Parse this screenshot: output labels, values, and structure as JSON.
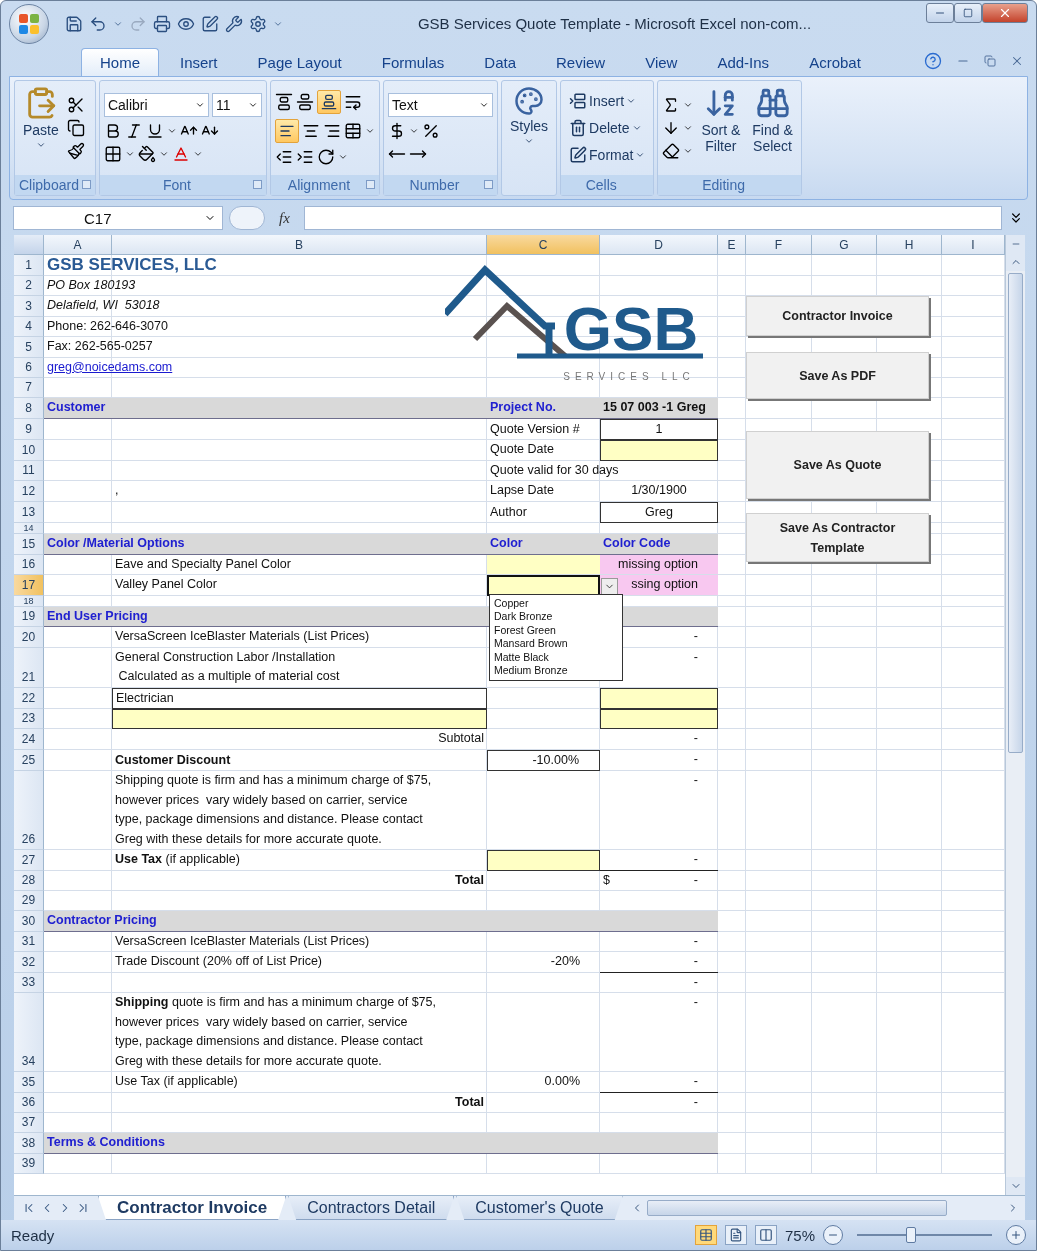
{
  "window": {
    "title": "GSB Services Quote Template - Microsoft Excel non-com..."
  },
  "ribbon_tabs": [
    {
      "label": "Home",
      "selected": true
    },
    {
      "label": "Insert",
      "selected": false
    },
    {
      "label": "Page Layout",
      "selected": false
    },
    {
      "label": "Formulas",
      "selected": false
    },
    {
      "label": "Data",
      "selected": false
    },
    {
      "label": "Review",
      "selected": false
    },
    {
      "label": "View",
      "selected": false
    },
    {
      "label": "Add-Ins",
      "selected": false
    },
    {
      "label": "Acrobat",
      "selected": false
    }
  ],
  "ribbon_groups": [
    {
      "kind": "clipboard",
      "label": "Clipboard",
      "button": "Paste"
    },
    {
      "kind": "font",
      "label": "Font",
      "font_name": "Calibri",
      "font_size": "11"
    },
    {
      "kind": "alignment",
      "label": "Alignment"
    },
    {
      "kind": "number",
      "label": "Number",
      "format": "Text"
    },
    {
      "kind": "styles",
      "button": "Styles"
    },
    {
      "kind": "cells",
      "label": "Cells",
      "buttons": [
        "Insert",
        "Delete",
        "Format"
      ]
    },
    {
      "kind": "editing",
      "label": "Editing",
      "buttons": [
        "Sort &\nFilter",
        "Find &\nSelect"
      ]
    }
  ],
  "formula_bar": {
    "name_box": "C17",
    "function_label": "fx"
  },
  "columns": [
    {
      "label": "A",
      "selected": false
    },
    {
      "label": "B",
      "selected": false
    },
    {
      "label": "C",
      "selected": true
    },
    {
      "label": "D",
      "selected": false
    },
    {
      "label": "E",
      "selected": false
    },
    {
      "label": "F",
      "selected": false
    },
    {
      "label": "G",
      "selected": false
    },
    {
      "label": "H",
      "selected": false
    },
    {
      "label": "I",
      "selected": false
    }
  ],
  "rows": [
    {
      "number": "1",
      "kind": "normal",
      "selected": false,
      "a": {
        "kind": "title",
        "text": "GSB SERVICES, LLC"
      }
    },
    {
      "number": "2",
      "kind": "normal",
      "selected": false,
      "a": {
        "kind": "italic",
        "text": "PO Box 180193"
      }
    },
    {
      "number": "3",
      "kind": "normal",
      "selected": false,
      "a": {
        "kind": "italic",
        "text": "Delafield, WI  53018"
      }
    },
    {
      "number": "4",
      "kind": "normal",
      "selected": false,
      "a": {
        "kind": "text",
        "text": "Phone: 262-646-3070"
      }
    },
    {
      "number": "5",
      "kind": "normal",
      "selected": false,
      "a": {
        "kind": "text",
        "text": "Fax: 262-565-0257"
      }
    },
    {
      "number": "6",
      "kind": "normal",
      "selected": false,
      "a": {
        "kind": "link",
        "text": "greg@noicedams.com"
      }
    },
    {
      "number": "7",
      "kind": "normal",
      "selected": false
    },
    {
      "number": "8",
      "kind": "section",
      "selected": false,
      "a": {
        "kind": "heading",
        "text": "Customer"
      },
      "c": {
        "kind": "heading",
        "text": "Project No."
      },
      "d": {
        "kind": "bold",
        "text": "15 07 003 -1 Greg"
      }
    },
    {
      "number": "9",
      "kind": "normal",
      "selected": false,
      "c": {
        "kind": "text",
        "text": "Quote Version #"
      },
      "d": {
        "kind": "center",
        "boxed": true,
        "text": "1"
      }
    },
    {
      "number": "10",
      "kind": "normal",
      "selected": false,
      "c": {
        "kind": "text",
        "text": "Quote Date"
      },
      "d": {
        "kind": "input",
        "boxed": true
      }
    },
    {
      "number": "11",
      "kind": "normal",
      "selected": false,
      "c": {
        "kind": "text",
        "text": "Quote valid for 30 days"
      }
    },
    {
      "number": "12",
      "kind": "normal",
      "selected": false,
      "b": {
        "kind": "text",
        "text": ","
      },
      "c": {
        "kind": "text",
        "text": "Lapse Date"
      },
      "d": {
        "kind": "center",
        "text": "1/30/1900"
      }
    },
    {
      "number": "13",
      "kind": "normal",
      "selected": false,
      "c": {
        "kind": "text",
        "text": "Author"
      },
      "d": {
        "kind": "center",
        "boxed": true,
        "text": "Greg"
      }
    },
    {
      "number": "14",
      "kind": "short",
      "selected": false
    },
    {
      "number": "15",
      "kind": "section",
      "selected": false,
      "a": {
        "kind": "heading",
        "text": "Color /Material Options"
      },
      "c": {
        "kind": "heading",
        "text": "Color"
      },
      "d": {
        "kind": "heading",
        "text": "Color Code"
      }
    },
    {
      "number": "16",
      "kind": "normal",
      "selected": false,
      "b": {
        "kind": "text",
        "text": "Eave and Specialty Panel Color"
      },
      "c": {
        "kind": "input"
      },
      "d": {
        "kind": "missing",
        "text": "missing option"
      }
    },
    {
      "number": "17",
      "kind": "normal",
      "selected": true,
      "b": {
        "kind": "text",
        "text": "Valley Panel Color"
      },
      "c": {
        "kind": "input"
      },
      "d": {
        "kind": "missing",
        "text": "ssing option"
      }
    },
    {
      "number": "18",
      "kind": "short",
      "selected": false
    },
    {
      "number": "19",
      "kind": "section",
      "selected": false,
      "a": {
        "kind": "heading",
        "text": "End User Pricing"
      }
    },
    {
      "number": "20",
      "kind": "normal",
      "selected": false,
      "b": {
        "kind": "text",
        "text": "VersaScreen IceBlaster Materials (List Prices)"
      },
      "d": {
        "kind": "number",
        "text": "-"
      }
    },
    {
      "number": "21",
      "kind": "normal",
      "selected": false,
      "b": {
        "kind": "text",
        "text": "General Construction Labor /Installation\n Calculated as a multiple of material cost"
      },
      "d": {
        "kind": "number",
        "text": "-"
      }
    },
    {
      "number": "22",
      "kind": "normal",
      "selected": false,
      "b": {
        "kind": "text",
        "boxed": true,
        "text": "Electrician"
      },
      "c": {
        "kind": "text"
      },
      "d": {
        "kind": "input",
        "boxed": true
      }
    },
    {
      "number": "23",
      "kind": "normal",
      "selected": false,
      "b": {
        "kind": "input",
        "boxed": true
      },
      "c": {
        "kind": "text"
      },
      "d": {
        "kind": "input",
        "boxed": true
      }
    },
    {
      "number": "24",
      "kind": "normal",
      "selected": false,
      "b": {
        "kind": "right",
        "text": "Subtotal"
      },
      "d": {
        "kind": "number",
        "text": "-"
      }
    },
    {
      "number": "25",
      "kind": "normal",
      "selected": false,
      "b": {
        "kind": "bold",
        "text": "Customer Discount"
      },
      "c": {
        "kind": "number",
        "boxed": true,
        "text": "-10.00%"
      },
      "d": {
        "kind": "number",
        "text": "-"
      }
    },
    {
      "number": "26",
      "kind": "normal",
      "selected": false,
      "b": {
        "kind": "text",
        "text": "Shipping quote is firm and has a minimum charge of $75,\nhowever prices  vary widely based on carrier, service\ntype, package dimensions and distance. Please contact\nGreg with these details for more accurate quote."
      },
      "d": {
        "kind": "number",
        "text": "-"
      }
    },
    {
      "number": "27",
      "kind": "normal",
      "selected": false,
      "b": {
        "kind": "text",
        "text": "**Use Tax** (if applicable)"
      },
      "c": {
        "kind": "input",
        "boxed": true
      },
      "d": {
        "kind": "number",
        "underlined": true,
        "text": "-"
      }
    },
    {
      "number": "28",
      "kind": "normal",
      "selected": false,
      "b": {
        "kind": "total",
        "text": "Total"
      },
      "d": {
        "kind": "number",
        "prefix": "$",
        "text": "-"
      }
    },
    {
      "number": "29",
      "kind": "normal",
      "selected": false
    },
    {
      "number": "30",
      "kind": "section",
      "selected": false,
      "a": {
        "kind": "heading",
        "text": "Contractor Pricing"
      }
    },
    {
      "number": "31",
      "kind": "normal",
      "selected": false,
      "b": {
        "kind": "text",
        "text": "VersaScreen IceBlaster Materials (List Prices)"
      },
      "d": {
        "kind": "number",
        "text": "-"
      }
    },
    {
      "number": "32",
      "kind": "normal",
      "selected": false,
      "b": {
        "kind": "text",
        "text": "Trade Discount (20% off of List Price)"
      },
      "c": {
        "kind": "number",
        "text": "-20%"
      },
      "d": {
        "kind": "number",
        "underlined": true,
        "text": "-"
      }
    },
    {
      "number": "33",
      "kind": "normal",
      "selected": false,
      "d": {
        "kind": "number",
        "text": "-"
      }
    },
    {
      "number": "34",
      "kind": "normal",
      "selected": false,
      "b": {
        "kind": "text",
        "text": "**Shipping** quote is firm and has a minimum charge of $75,\nhowever prices  vary widely based on carrier, service\ntype, package dimensions and distance. Please contact\nGreg with these details for more accurate quote."
      },
      "d": {
        "kind": "number",
        "text": "-"
      }
    },
    {
      "number": "35",
      "kind": "normal",
      "selected": false,
      "b": {
        "kind": "text",
        "text": "Use Tax (if applicable)"
      },
      "c": {
        "kind": "number",
        "text": "0.00%"
      },
      "d": {
        "kind": "number",
        "underlined": true,
        "text": "-"
      }
    },
    {
      "number": "36",
      "kind": "normal",
      "selected": false,
      "b": {
        "kind": "total",
        "text": "Total"
      },
      "d": {
        "kind": "number",
        "text": "-"
      }
    },
    {
      "number": "37",
      "kind": "normal",
      "selected": false
    },
    {
      "number": "38",
      "kind": "section",
      "selected": false,
      "a": {
        "kind": "heading",
        "text": "Terms & Conditions"
      }
    },
    {
      "number": "39",
      "kind": "normal",
      "selected": false
    }
  ],
  "validation_dropdown": {
    "options": [
      "Copper",
      "Dark Bronze",
      "Forest Green",
      "Mansard Brown",
      "Matte Black",
      "Medium Bronze"
    ]
  },
  "logo": {
    "letters": "GSB",
    "tagline": "SERVICES LLC"
  },
  "macro_buttons": [
    "Contractor Invoice",
    "Save As PDF",
    "Save As Quote",
    "Save As Contractor Template"
  ],
  "sheet_tabs": [
    {
      "label": "Contractor Invoice",
      "selected": true
    },
    {
      "label": "Contractors Detail",
      "selected": false
    },
    {
      "label": "Customer's Quote",
      "selected": false
    }
  ],
  "status_bar": {
    "status": "Ready",
    "zoom": "75%",
    "zoom_slider": {
      "level": 0.4
    }
  }
}
